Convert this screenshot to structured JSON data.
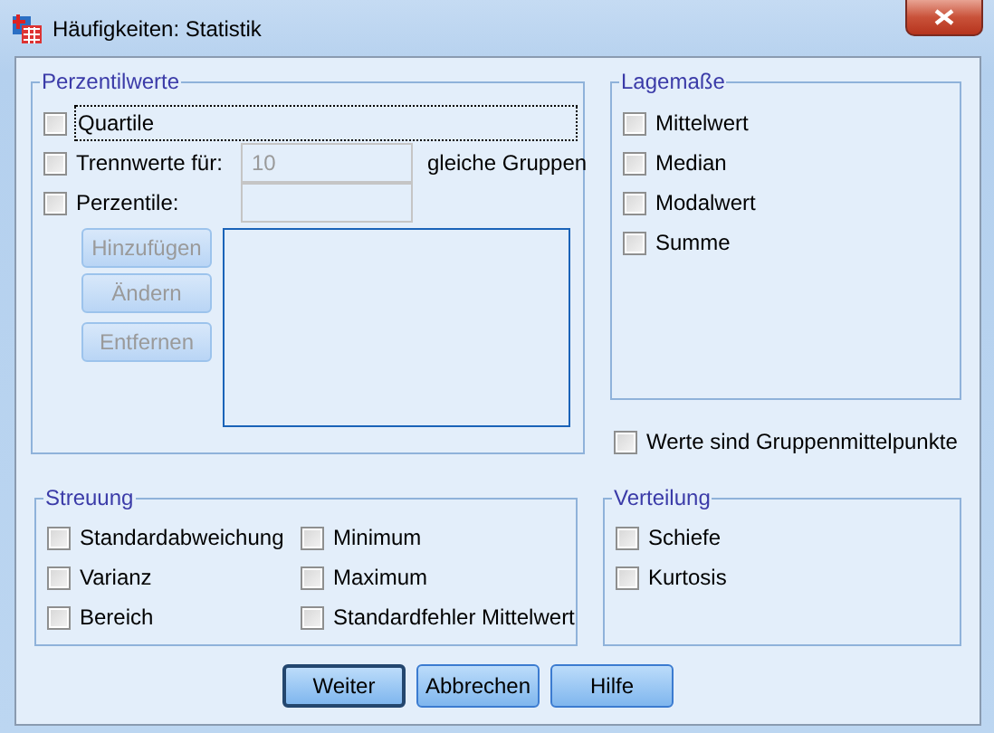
{
  "window": {
    "title": "Häufigkeiten: Statistik"
  },
  "percentile_values": {
    "title": "Perzentilwerte",
    "options": [
      {
        "kind": "plain",
        "label": "Quartile",
        "checked": false,
        "focused": true
      },
      {
        "kind": "field",
        "label": "Trennwerte für:",
        "checked": false,
        "focused": false,
        "value": "10",
        "suffix": "gleiche Gruppen"
      },
      {
        "kind": "field",
        "label": "Perzentile:",
        "checked": false,
        "focused": false
      }
    ],
    "buttons": [
      {
        "label": "Hinzufügen",
        "disabled": true
      },
      {
        "label": "Ändern",
        "disabled": true
      },
      {
        "label": "Entfernen",
        "disabled": true
      }
    ]
  },
  "central_tendency": {
    "title": "Lagemaße",
    "options": [
      {
        "label": "Mittelwert",
        "checked": false
      },
      {
        "label": "Median",
        "checked": false
      },
      {
        "label": "Modalwert",
        "checked": false
      },
      {
        "label": "Summe",
        "checked": false
      }
    ]
  },
  "group_midpoints": {
    "label": "Werte sind Gruppenmittelpunkte",
    "checked": false
  },
  "dispersion": {
    "title": "Streuung",
    "options": [
      {
        "label": "Standardabweichung",
        "checked": false
      },
      {
        "label": "Minimum",
        "checked": false
      },
      {
        "label": "Varianz",
        "checked": false
      },
      {
        "label": "Maximum",
        "checked": false
      },
      {
        "label": "Bereich",
        "checked": false
      },
      {
        "label": "Standardfehler Mittelwert",
        "checked": false
      }
    ]
  },
  "distribution": {
    "title": "Verteilung",
    "options": [
      {
        "label": "Schiefe",
        "checked": false
      },
      {
        "label": "Kurtosis",
        "checked": false
      }
    ]
  },
  "buttons": [
    {
      "label": "Weiter",
      "default": true
    },
    {
      "label": "Abbrechen",
      "default": false
    },
    {
      "label": "Hilfe",
      "default": false
    }
  ]
}
